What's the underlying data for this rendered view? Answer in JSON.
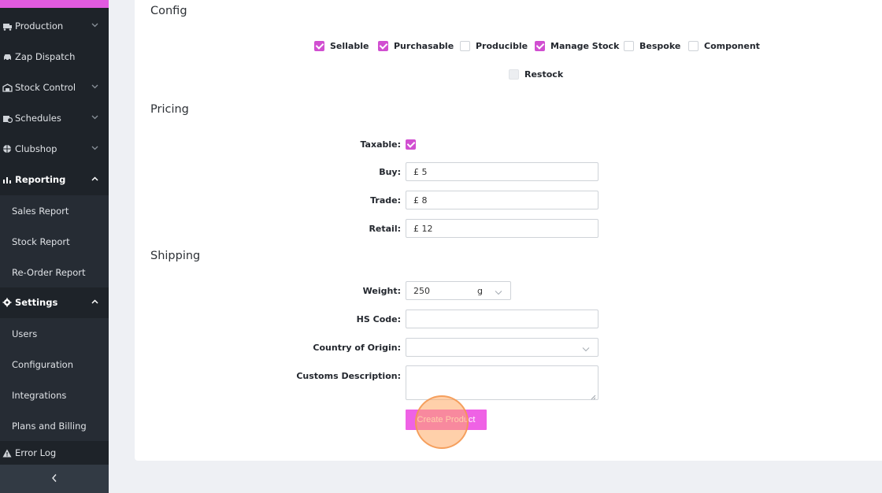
{
  "sidebar": {
    "items": [
      {
        "label": "Production",
        "icon": "truck-loading-icon",
        "expandable": true,
        "expanded": false
      },
      {
        "label": "Zap Dispatch",
        "icon": "car-icon",
        "expandable": false
      },
      {
        "label": "Stock Control",
        "icon": "warehouse-icon",
        "expandable": true,
        "expanded": false
      },
      {
        "label": "Schedules",
        "icon": "calendar-clock-icon",
        "expandable": true,
        "expanded": false
      },
      {
        "label": "Clubshop",
        "icon": "basketball-icon",
        "expandable": true,
        "expanded": false
      },
      {
        "label": "Reporting",
        "icon": "chart-bar-icon",
        "expandable": true,
        "expanded": true
      },
      {
        "label": "Settings",
        "icon": "gear-icon",
        "expandable": true,
        "expanded": true
      },
      {
        "label": "Error Log",
        "icon": "warning-icon",
        "expandable": false
      }
    ],
    "reporting_sub": [
      "Sales Report",
      "Stock Report",
      "Re-Order Report"
    ],
    "settings_sub": [
      "Users",
      "Configuration",
      "Integrations",
      "Plans and Billing"
    ],
    "collapse_icon": "chevron-left-icon",
    "accent": "#e25be0"
  },
  "config": {
    "title": "Config",
    "options": [
      {
        "label": "Sellable",
        "checked": true
      },
      {
        "label": "Purchasable",
        "checked": true
      },
      {
        "label": "Producible",
        "checked": false
      },
      {
        "label": "Manage Stock",
        "checked": true
      },
      {
        "label": "Bespoke",
        "checked": false
      },
      {
        "label": "Component",
        "checked": false
      },
      {
        "label": "Restock",
        "checked": false,
        "disabled": true
      }
    ]
  },
  "pricing": {
    "title": "Pricing",
    "taxable_label": "Taxable:",
    "taxable_checked": true,
    "buy_label": "Buy:",
    "buy_value": "£ 5",
    "trade_label": "Trade:",
    "trade_value": "£ 8",
    "retail_label": "Retail:",
    "retail_value": "£ 12"
  },
  "shipping": {
    "title": "Shipping",
    "weight_label": "Weight:",
    "weight_value": "250",
    "weight_unit": "g",
    "hs_label": "HS Code:",
    "hs_value": "",
    "country_label": "Country of Origin:",
    "country_value": "",
    "customs_label": "Customs Description:",
    "customs_value": ""
  },
  "actions": {
    "create_label": "Create Product",
    "create_color": "#ef62e5"
  },
  "colors": {
    "check": "#d14fd1",
    "sidebar_bg": "#1e2329",
    "page_bg": "#eef0f4"
  }
}
